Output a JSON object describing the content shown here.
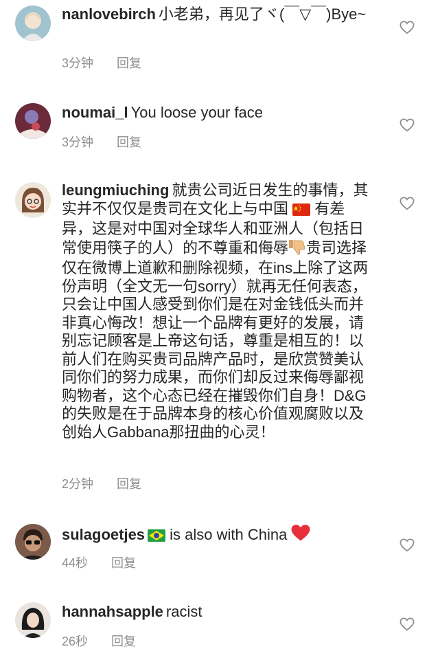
{
  "comments": [
    {
      "username": "nanlovebirch",
      "text": "小老弟，再见了ヾ(￣▽￣)Bye~",
      "time": "3分钟",
      "reply": "回复"
    },
    {
      "username": "noumai_l",
      "text": "You loose your face",
      "time": "3分钟",
      "reply": "回复"
    },
    {
      "username": "leungmiuching",
      "text_a": "就贵公司近日发生的事情，其实并不仅仅是贵司在文化上与中国",
      "text_b": "有差异，这是对中国对全球华人和亚洲人（包括日常使用筷子的人）的不尊重和侮辱",
      "text_c": "贵司选择仅在微博上道歉和删除视频，在ins上除了这两份声明（全文无一句sorry）就再无任何表态，只会让中国人感受到你们是在对金钱低头而并非真心悔改！想让一个品牌有更好的发展，请别忘记顾客是上帝这句话，尊重是相互的！以前人们在购买贵司品牌产品时，是欣赏赞美认同你们的努力成果，而你们却反过来侮辱鄙视购物者，这个心态已经在摧毁你们自身！D&G的失败是在于品牌本身的核心价值观腐败以及创始人Gabbana那扭曲的心灵！",
      "time": "2分钟",
      "reply": "回复"
    },
    {
      "username": "sulagoetjes",
      "text": "is also with China",
      "time": "44秒",
      "reply": "回复"
    },
    {
      "username": "hannahsapple",
      "text": "racist",
      "time": "26秒",
      "reply": "回复"
    }
  ],
  "icons": {
    "like": "heart-outline-icon",
    "china_flag": "china-flag-icon",
    "brazil_flag": "brazil-flag-icon",
    "thumbs_down": "thumbs-down-icon",
    "red_heart": "red-heart-icon"
  },
  "colors": {
    "text": "#262626",
    "meta": "#8e8e8e",
    "heart_outline": "#8e8e8e",
    "red_heart": "#e8303d"
  }
}
